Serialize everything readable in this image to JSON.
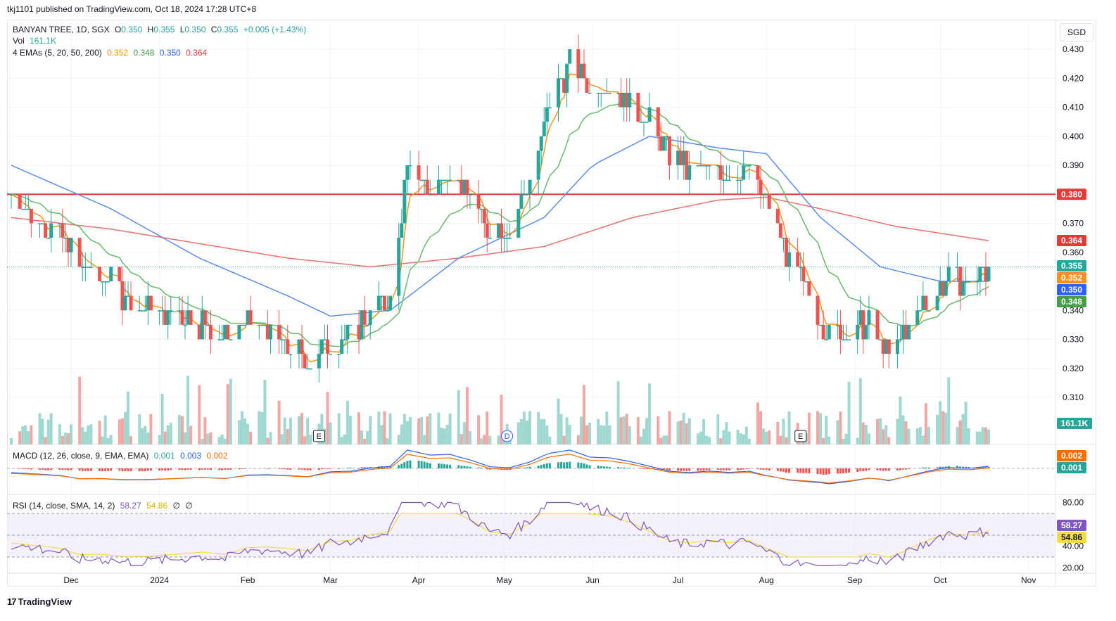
{
  "publisher": "tkj1101 published on TradingView.com, Oct 18, 2024 17:28 UTC+8",
  "brand": "TradingView",
  "currency": "SGD",
  "colors": {
    "up": "#26a69a",
    "down": "#ef5350",
    "ema5": "#f7931a",
    "ema20": "#66bb6a",
    "ema50": "#5b8def",
    "ema200": "#f06e6e",
    "resistance": "#e53935",
    "macd": "#2962ff",
    "signal": "#ff6d00",
    "rsi": "#7e57c2",
    "rsiSma": "#f5d94e"
  },
  "legend": {
    "symbol": "BANYAN TREE, 1D, SGX",
    "open_label": "O",
    "open": "0.350",
    "high_label": "H",
    "high": "0.355",
    "low_label": "L",
    "low": "0.350",
    "close_label": "C",
    "close": "0.355",
    "change": "+0.005 (+1.43%)",
    "vol_label": "Vol",
    "vol": "161.1K",
    "ema_label": "4 EMAs (5, 20, 50, 200)",
    "ema5": "0.352",
    "ema20": "0.348",
    "ema50": "0.350",
    "ema200": "0.364"
  },
  "macd_legend": {
    "label": "MACD (12, 26, close, 9, EMA, EMA)",
    "hist": "0.001",
    "macd": "0.003",
    "signal": "0.002"
  },
  "rsi_legend": {
    "label": "RSI (14, close, SMA, 14, 2)",
    "rsi": "58.27",
    "sma": "54.86",
    "extra1": "∅",
    "extra2": "∅"
  },
  "chart_data": {
    "type": "candlestick",
    "y_axis": {
      "min": 0.305,
      "max": 0.435,
      "ticks": [
        "0.430",
        "0.420",
        "0.410",
        "0.400",
        "0.390",
        "0.370",
        "0.360",
        "0.340",
        "0.330",
        "0.320",
        "0.310"
      ]
    },
    "x_axis_labels": [
      {
        "label": "Dec",
        "date": "2023-12-01"
      },
      {
        "label": "2024",
        "date": "2024-01-01"
      },
      {
        "label": "Feb",
        "date": "2024-02-01"
      },
      {
        "label": "Mar",
        "date": "2024-03-01"
      },
      {
        "label": "Apr",
        "date": "2024-04-01"
      },
      {
        "label": "May",
        "date": "2024-05-01"
      },
      {
        "label": "Jun",
        "date": "2024-06-01"
      },
      {
        "label": "Jul",
        "date": "2024-07-01"
      },
      {
        "label": "Aug",
        "date": "2024-08-01"
      },
      {
        "label": "Sep",
        "date": "2024-09-01"
      },
      {
        "label": "Oct",
        "date": "2024-10-01"
      },
      {
        "label": "Nov",
        "date": "2024-11-01"
      }
    ],
    "date_range": [
      "2023-11-10",
      "2024-10-18"
    ],
    "close_series": [
      [
        "2023-11-10",
        0.38
      ],
      [
        "2023-11-20",
        0.372
      ],
      [
        "2023-11-27",
        0.366
      ],
      [
        "2023-12-04",
        0.355
      ],
      [
        "2023-12-12",
        0.352
      ],
      [
        "2023-12-20",
        0.345
      ],
      [
        "2023-12-28",
        0.341
      ],
      [
        "2024-01-08",
        0.338
      ],
      [
        "2024-01-16",
        0.336
      ],
      [
        "2024-01-24",
        0.33
      ],
      [
        "2024-02-01",
        0.335
      ],
      [
        "2024-02-08",
        0.333
      ],
      [
        "2024-02-15",
        0.328
      ],
      [
        "2024-02-22",
        0.322
      ],
      [
        "2024-03-01",
        0.33
      ],
      [
        "2024-03-08",
        0.332
      ],
      [
        "2024-03-15",
        0.34
      ],
      [
        "2024-03-22",
        0.345
      ],
      [
        "2024-03-28",
        0.388
      ],
      [
        "2024-04-05",
        0.382
      ],
      [
        "2024-04-12",
        0.389
      ],
      [
        "2024-04-19",
        0.38
      ],
      [
        "2024-04-26",
        0.367
      ],
      [
        "2024-05-03",
        0.368
      ],
      [
        "2024-05-10",
        0.385
      ],
      [
        "2024-05-17",
        0.41
      ],
      [
        "2024-05-24",
        0.425
      ],
      [
        "2024-05-31",
        0.416
      ],
      [
        "2024-06-07",
        0.418
      ],
      [
        "2024-06-14",
        0.413
      ],
      [
        "2024-06-21",
        0.405
      ],
      [
        "2024-06-28",
        0.392
      ],
      [
        "2024-07-05",
        0.388
      ],
      [
        "2024-07-12",
        0.39
      ],
      [
        "2024-07-19",
        0.386
      ],
      [
        "2024-07-26",
        0.388
      ],
      [
        "2024-08-02",
        0.375
      ],
      [
        "2024-08-09",
        0.357
      ],
      [
        "2024-08-16",
        0.345
      ],
      [
        "2024-08-23",
        0.333
      ],
      [
        "2024-08-30",
        0.333
      ],
      [
        "2024-09-06",
        0.335
      ],
      [
        "2024-09-13",
        0.325
      ],
      [
        "2024-09-20",
        0.335
      ],
      [
        "2024-09-27",
        0.345
      ],
      [
        "2024-10-04",
        0.352
      ],
      [
        "2024-10-11",
        0.35
      ],
      [
        "2024-10-18",
        0.355
      ]
    ],
    "ema200_series": [
      [
        "2023-11-10",
        0.372
      ],
      [
        "2023-12-15",
        0.368
      ],
      [
        "2024-01-15",
        0.363
      ],
      [
        "2024-02-15",
        0.358
      ],
      [
        "2024-03-15",
        0.355
      ],
      [
        "2024-04-15",
        0.358
      ],
      [
        "2024-05-15",
        0.362
      ],
      [
        "2024-06-15",
        0.372
      ],
      [
        "2024-07-15",
        0.378
      ],
      [
        "2024-08-01",
        0.379
      ],
      [
        "2024-08-20",
        0.375
      ],
      [
        "2024-09-15",
        0.369
      ],
      [
        "2024-10-18",
        0.364
      ]
    ],
    "ema50_series": [
      [
        "2023-11-10",
        0.39
      ],
      [
        "2023-12-15",
        0.375
      ],
      [
        "2024-01-15",
        0.358
      ],
      [
        "2024-02-15",
        0.345
      ],
      [
        "2024-03-01",
        0.338
      ],
      [
        "2024-03-22",
        0.34
      ],
      [
        "2024-04-15",
        0.358
      ],
      [
        "2024-05-15",
        0.372
      ],
      [
        "2024-06-01",
        0.39
      ],
      [
        "2024-06-21",
        0.4
      ],
      [
        "2024-07-15",
        0.396
      ],
      [
        "2024-08-01",
        0.394
      ],
      [
        "2024-08-20",
        0.372
      ],
      [
        "2024-09-10",
        0.355
      ],
      [
        "2024-10-01",
        0.35
      ],
      [
        "2024-10-18",
        0.35
      ]
    ],
    "resistance_line": 0.38,
    "price_labels": [
      "0.380",
      "0.364",
      "0.355",
      "0.352",
      "0.350",
      "0.348"
    ],
    "volume_last": "161.1K",
    "earnings_markers": [
      {
        "label": "E",
        "date": "2024-02-26"
      },
      {
        "label": "E",
        "date": "2024-08-13"
      }
    ],
    "dividend_markers": [
      {
        "label": "D",
        "date": "2024-05-02"
      }
    ],
    "macd_panel": {
      "price_labels": [
        "0.002",
        "0.001"
      ]
    },
    "rsi_panel": {
      "ticks": [
        "80.00",
        "40.00",
        "20.00"
      ],
      "bands": [
        70,
        50,
        30
      ],
      "labels": [
        "58.27",
        "54.86"
      ]
    }
  }
}
